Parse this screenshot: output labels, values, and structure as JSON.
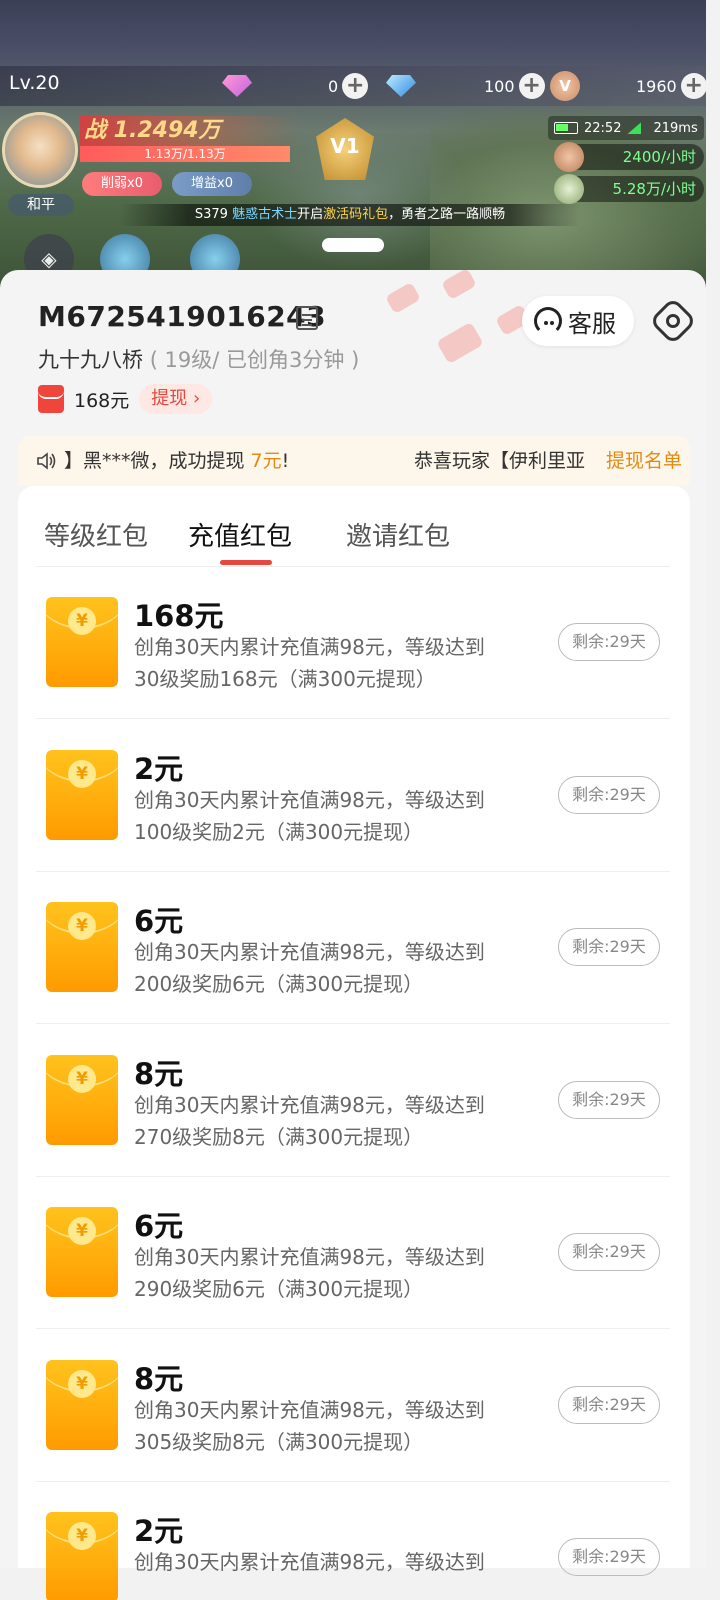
{
  "hud": {
    "level": "Lv.20",
    "pink_gem": "0",
    "blue_gem": "100",
    "coins": "1960",
    "coin_letter": "V",
    "player_name": "和平",
    "power": "战 1.2494万",
    "hp": "1.13万/1.13万",
    "debuff": "削弱x0",
    "buff": "增益x0",
    "vip": "V1",
    "time": "22:52",
    "ping": "219ms",
    "gold_rate": "2400/小时",
    "exp_rate": "5.28万/小时",
    "announcement": {
      "prefix": "S379",
      "name": "魅惑古术士",
      "mid": "开启",
      "item": "激活码礼包",
      "suffix": "，勇者之路一路顺畅"
    }
  },
  "account": {
    "uid": "M6725419016243",
    "role_name": "九十九八桥",
    "role_info": "( 19级/ 已创角3分钟 )",
    "balance": "168元",
    "withdraw_label": "提现 ›",
    "support_label": "客服"
  },
  "notice": {
    "text_pre": "】黑***微，成功提现 ",
    "text_amount": "7元",
    "text_post": "!",
    "text_2": "恭喜玩家【伊利里亚",
    "link": "提现名单"
  },
  "tabs": [
    "等级红包",
    "充值红包",
    "邀请红包"
  ],
  "active_tab": 1,
  "rewards": [
    {
      "amount": "168元",
      "line1": "创角30天内累计充值满98元，等级达到",
      "line2": "30级奖励168元（满300元提现）",
      "remain": "剩余:29天"
    },
    {
      "amount": "2元",
      "line1": "创角30天内累计充值满98元，等级达到",
      "line2": "100级奖励2元（满300元提现）",
      "remain": "剩余:29天"
    },
    {
      "amount": "6元",
      "line1": "创角30天内累计充值满98元，等级达到",
      "line2": "200级奖励6元（满300元提现）",
      "remain": "剩余:29天"
    },
    {
      "amount": "8元",
      "line1": "创角30天内累计充值满98元，等级达到",
      "line2": "270级奖励8元（满300元提现）",
      "remain": "剩余:29天"
    },
    {
      "amount": "6元",
      "line1": "创角30天内累计充值满98元，等级达到",
      "line2": "290级奖励6元（满300元提现）",
      "remain": "剩余:29天"
    },
    {
      "amount": "8元",
      "line1": "创角30天内累计充值满98元，等级达到",
      "line2": "305级奖励8元（满300元提现）",
      "remain": "剩余:29天"
    },
    {
      "amount": "2元",
      "line1": "创角30天内累计充值满98元，等级达到",
      "line2": "",
      "remain": "剩余:29天"
    }
  ],
  "envelope_symbol": "¥",
  "colors": {
    "accent_red": "#e5483e",
    "accent_orange": "#e38a14",
    "envelope": "#ffb00f"
  }
}
